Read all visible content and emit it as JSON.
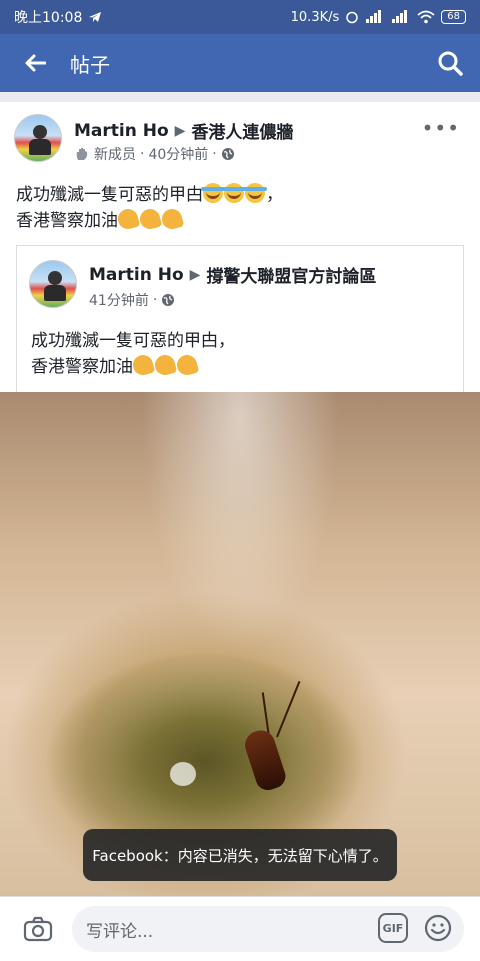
{
  "status_bar": {
    "time": "晚上10:08",
    "network_speed": "10.3K/s",
    "battery": "68"
  },
  "app_bar": {
    "title": "帖子"
  },
  "post": {
    "author": "Martin Ho",
    "group": "香港人連儂牆",
    "badge": "新成员",
    "time": "40分钟前",
    "separator": "·",
    "text_line1": "成功殲滅一隻可惡的甲甴",
    "text_line1_suffix": "，",
    "text_line2": "香港警察加油",
    "shared": {
      "author": "Martin Ho",
      "group": "撐警大聯盟官方討論區",
      "time": "41分钟前",
      "text_line1": "成功殲滅一隻可惡的甲甴，",
      "text_line2": "香港警察加油"
    }
  },
  "toast": {
    "text": "Facebook：内容已消失，无法留下心情了。"
  },
  "comment_bar": {
    "placeholder": "写评论...",
    "gif_label": "GIF"
  }
}
